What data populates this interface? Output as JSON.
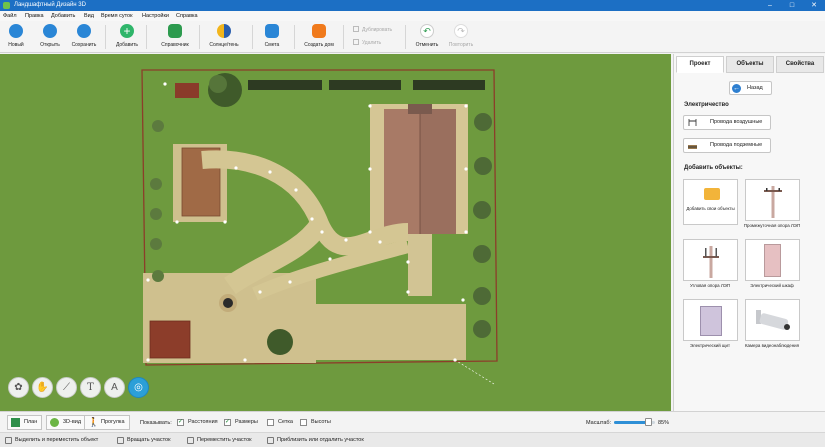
{
  "window": {
    "title": "Ландшафтный Дизайн 3D",
    "controls": [
      "minimize-icon",
      "maximize-icon",
      "close-icon"
    ]
  },
  "menu": [
    "Файл",
    "Правка",
    "Добавить",
    "Вид",
    "Время суток",
    "Настройки",
    "Справка"
  ],
  "toolbar": {
    "new": "Новый",
    "open": "Открыть",
    "save": "Сохранить",
    "add": "Добавить",
    "reference": "Справочник",
    "sun_shade": "Солнце/тень",
    "estimate": "Смета",
    "build_house": "Создать дом",
    "duplicate": "Дублировать",
    "delete": "Удалить",
    "undo": "Отменить",
    "redo": "Повторить"
  },
  "panel": {
    "tabs": [
      "Проект",
      "Объекты",
      "Свойства"
    ],
    "active_tab": "Проект",
    "back": "Назад",
    "electricity_title": "Электричество",
    "overhead_wires": "Провода воздушные",
    "underground_wires": "Провода подземные",
    "add_objects_title": "Добавить объекты:",
    "objects": [
      "Добавить свои объекты",
      "Промежуточная опора ЛЭП",
      "Угловая опора ЛЭП",
      "Электрический шкаф",
      "Электрический щит",
      "Камера видеонаблюдения"
    ]
  },
  "view_modes": {
    "plan": "План",
    "view3d": "3D-вид",
    "walk": "Прогулка"
  },
  "show": {
    "label": "Показывать:",
    "distances": {
      "label": "Расстояния",
      "checked": true
    },
    "sizes": {
      "label": "Размеры",
      "checked": true
    },
    "grid": {
      "label": "Сетка",
      "checked": false
    },
    "heights": {
      "label": "Высоты",
      "checked": false
    }
  },
  "zoom": {
    "label": "Масштаб:",
    "value": "85%",
    "fraction": 0.85
  },
  "status": [
    "Выделить и переместить объект",
    "Вращать участок",
    "Переместить участок",
    "Приблизить или отдалить участок"
  ],
  "colors": {
    "titlebar": "#1c6fc4",
    "grass": "#6e9a3e",
    "path": "#d8c89a",
    "accent": "#2b9fd8"
  }
}
